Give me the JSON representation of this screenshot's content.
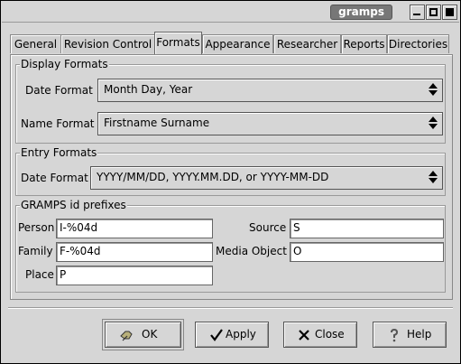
{
  "window": {
    "title": "gramps"
  },
  "tabs": [
    {
      "label": "General"
    },
    {
      "label": "Revision Control"
    },
    {
      "label": "Formats"
    },
    {
      "label": "Appearance"
    },
    {
      "label": "Researcher"
    },
    {
      "label": "Reports"
    },
    {
      "label": "Directories"
    }
  ],
  "display_formats": {
    "heading": "Display Formats",
    "date_label": "Date Format",
    "date_value": "Month Day, Year",
    "name_label": "Name Format",
    "name_value": "Firstname Surname"
  },
  "entry_formats": {
    "heading": "Entry Formats",
    "date_label": "Date Format",
    "date_value": "YYYY/MM/DD, YYYY.MM.DD, or YYYY-MM-DD"
  },
  "id_prefixes": {
    "heading": "GRAMPS id prefixes",
    "person_label": "Person",
    "person_value": "I-%04d",
    "family_label": "Family",
    "family_value": "F-%04d",
    "place_label": "Place",
    "place_value": "P",
    "source_label": "Source",
    "source_value": "S",
    "media_label": "Media Object",
    "media_value": "O"
  },
  "buttons": {
    "ok": "OK",
    "apply": "Apply",
    "close": "Close",
    "help": "Help"
  }
}
